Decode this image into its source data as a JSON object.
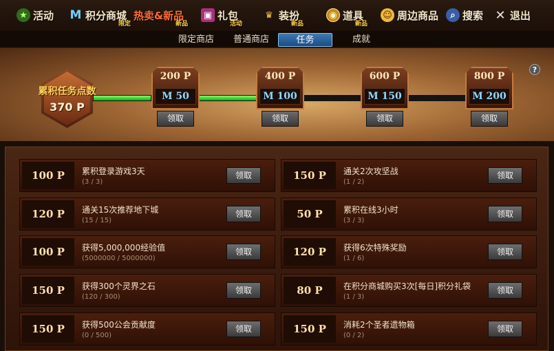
{
  "nav": [
    {
      "id": "activity",
      "label": "活动",
      "sub": "",
      "icon": "star-icon",
      "color": "#6bd34a"
    },
    {
      "id": "points-mall",
      "label": "积分商城",
      "sub": "限定",
      "icon": "m-logo-icon",
      "color": "#6fd0ff"
    },
    {
      "id": "hot-new",
      "label": "热卖&新品",
      "sub": "新品",
      "icon": "",
      "color": "#ff6a3a"
    },
    {
      "id": "gift",
      "label": "礼包",
      "sub": "活动",
      "icon": "gift-icon",
      "color": "#ff7ad6"
    },
    {
      "id": "outfit",
      "label": "装扮",
      "sub": "新品",
      "icon": "trophy-icon",
      "color": "#ffd04a"
    },
    {
      "id": "items",
      "label": "道具",
      "sub": "新品",
      "icon": "coin-icon",
      "color": "#ffc23a"
    },
    {
      "id": "merch",
      "label": "周边商品",
      "sub": "",
      "icon": "face-icon",
      "color": "#ffcf4a"
    },
    {
      "id": "search",
      "label": "搜索",
      "sub": "",
      "icon": "search-icon",
      "color": "#a9c8ff"
    },
    {
      "id": "exit",
      "label": "退出",
      "sub": "",
      "icon": "close-icon",
      "color": "#e8e8e8"
    }
  ],
  "tabs": [
    {
      "label": "限定商店",
      "active": false
    },
    {
      "label": "普通商店",
      "active": false
    },
    {
      "label": "任务",
      "active": true
    },
    {
      "label": "成就",
      "active": false
    }
  ],
  "progress": {
    "total_label": "累积任务点数",
    "total_value": "370 P",
    "help": "?",
    "milestones": [
      {
        "points": "200 P",
        "reward": "M 50",
        "claim": "领取"
      },
      {
        "points": "400 P",
        "reward": "M 100",
        "claim": "领取"
      },
      {
        "points": "600 P",
        "reward": "M 150",
        "claim": "领取"
      },
      {
        "points": "800 P",
        "reward": "M 200",
        "claim": "领取"
      }
    ],
    "reached_segments": 2
  },
  "tasks": [
    {
      "points": "100 P",
      "name": "累积登录游戏3天",
      "progress": "(3 / 3)",
      "claim": "领取"
    },
    {
      "points": "150 P",
      "name": "通关2次攻坚战",
      "progress": "(1 / 2)",
      "claim": "领取"
    },
    {
      "points": "120 P",
      "name": "通关15次推荐地下城",
      "progress": "(15 / 15)",
      "claim": "领取"
    },
    {
      "points": "50 P",
      "name": "累积在线3小时",
      "progress": "(3 / 3)",
      "claim": "领取"
    },
    {
      "points": "100 P",
      "name": "获得5,000,000经验值",
      "progress": "(5000000 / 5000000)",
      "claim": "领取"
    },
    {
      "points": "120 P",
      "name": "获得6次特殊奖励",
      "progress": "(1 / 6)",
      "claim": "领取"
    },
    {
      "points": "150 P",
      "name": "获得300个灵界之石",
      "progress": "(120 / 300)",
      "claim": "领取"
    },
    {
      "points": "80 P",
      "name": "在积分商城购买3次[每日]积分礼袋",
      "progress": "(1 / 3)",
      "claim": "领取"
    },
    {
      "points": "150 P",
      "name": "获得500公会贡献度",
      "progress": "(0 / 500)",
      "claim": "领取"
    },
    {
      "points": "150 P",
      "name": "消耗2个圣者遗物箱",
      "progress": "(0 / 2)",
      "claim": "领取"
    }
  ]
}
